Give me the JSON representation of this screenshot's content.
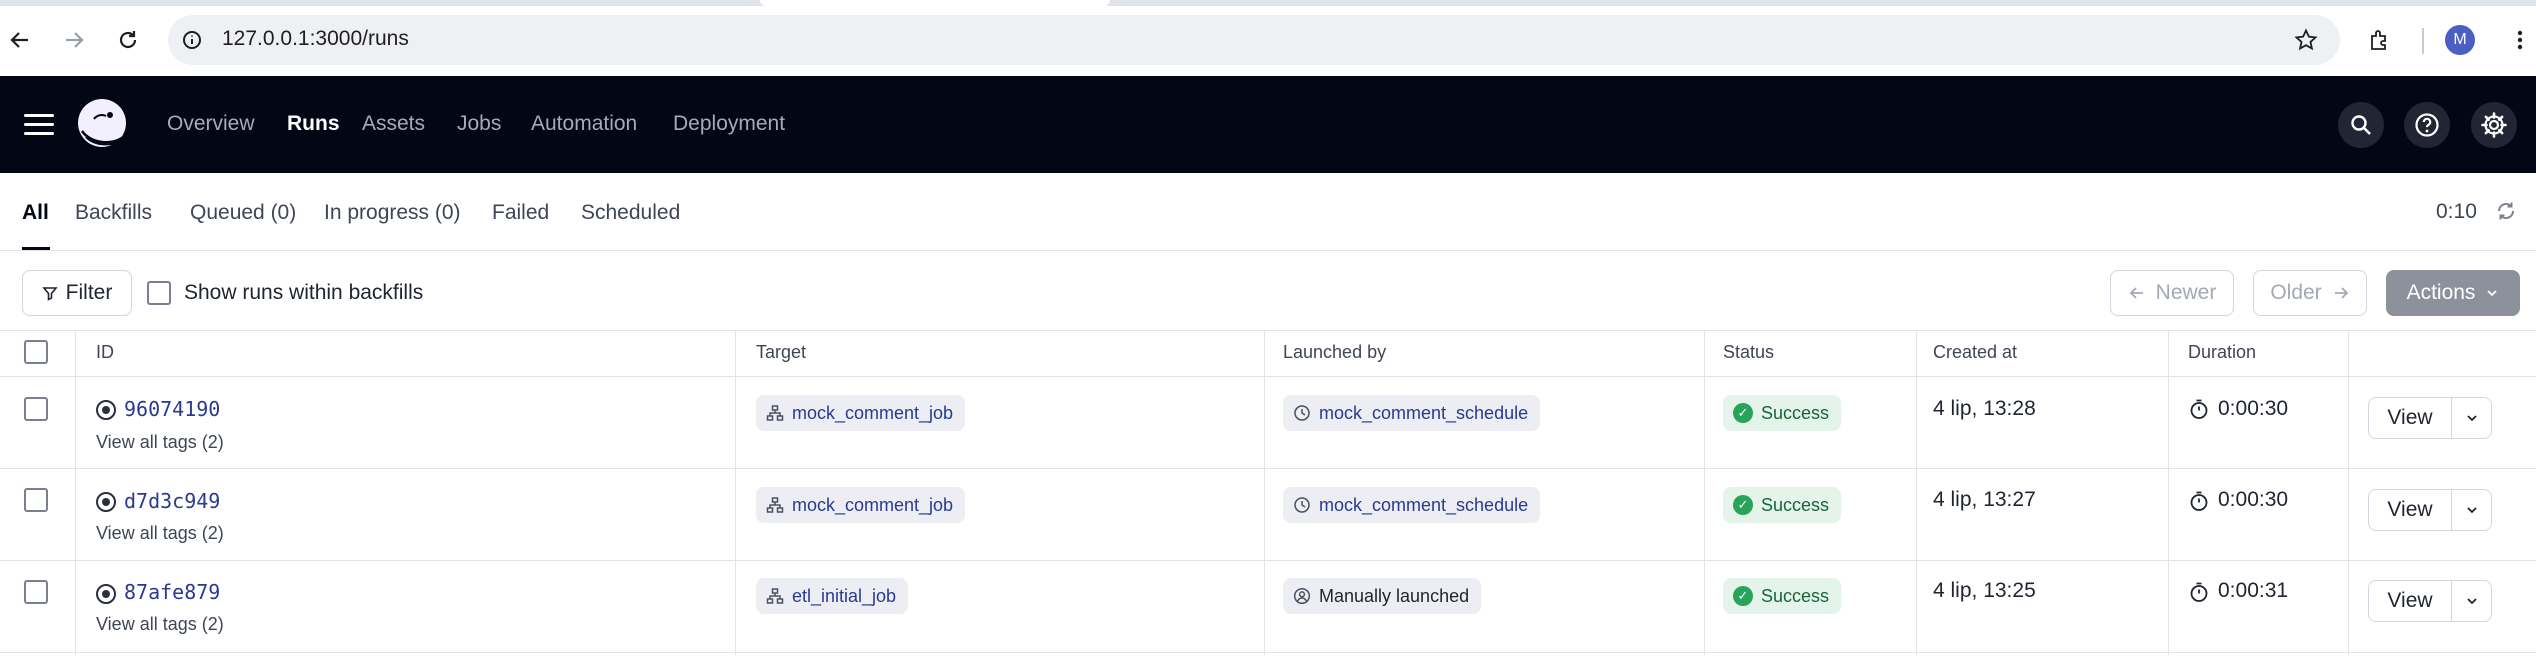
{
  "browser": {
    "url": "127.0.0.1:3000/runs",
    "profile_initial": "M"
  },
  "header": {
    "nav": [
      "Overview",
      "Runs",
      "Assets",
      "Jobs",
      "Automation",
      "Deployment"
    ],
    "active_nav": "Runs"
  },
  "tabs": {
    "items": [
      "All",
      "Backfills",
      "Queued (0)",
      "In progress (0)",
      "Failed",
      "Scheduled"
    ],
    "active": "All",
    "refresh_countdown": "0:10"
  },
  "toolbar": {
    "filter_label": "Filter",
    "show_backfills_label": "Show runs within backfills",
    "newer_label": "Newer",
    "older_label": "Older",
    "actions_label": "Actions"
  },
  "table": {
    "columns": [
      "ID",
      "Target",
      "Launched by",
      "Status",
      "Created at",
      "Duration"
    ],
    "rows": [
      {
        "id": "96074190",
        "tags": "View all tags (2)",
        "target": "mock_comment_job",
        "launched_by": "mock_comment_schedule",
        "launch_type": "schedule",
        "status": "Success",
        "created_at": "4 lip, 13:28",
        "duration": "0:00:30",
        "view": "View"
      },
      {
        "id": "d7d3c949",
        "tags": "View all tags (2)",
        "target": "mock_comment_job",
        "launched_by": "mock_comment_schedule",
        "launch_type": "schedule",
        "status": "Success",
        "created_at": "4 lip, 13:27",
        "duration": "0:00:30",
        "view": "View"
      },
      {
        "id": "87afe879",
        "tags": "View all tags (2)",
        "target": "etl_initial_job",
        "launched_by": "Manually launched",
        "launch_type": "manual",
        "status": "Success",
        "created_at": "4 lip, 13:25",
        "duration": "0:00:31",
        "view": "View"
      }
    ]
  },
  "colors": {
    "header_bg": "#030615",
    "success_bg": "#e5f4ea",
    "success_icon": "#27a35a",
    "link": "#2a3a8f",
    "actions_bg": "#8d919c"
  }
}
